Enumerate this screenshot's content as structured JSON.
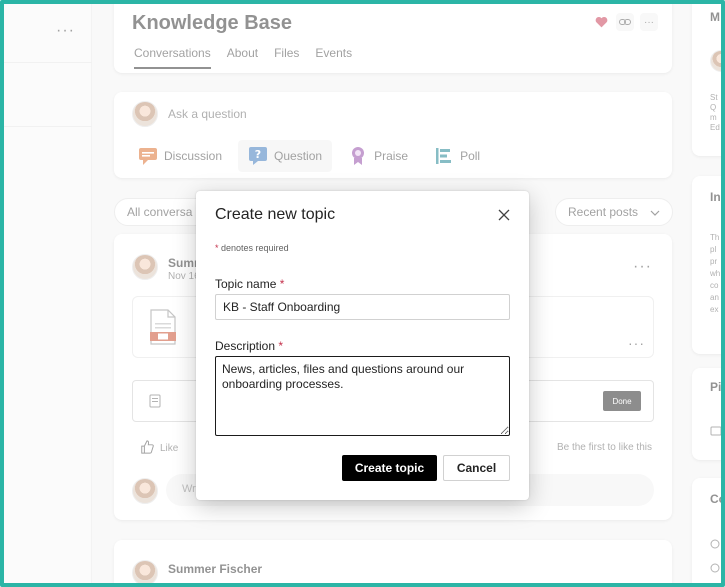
{
  "left_pane": {
    "more_label": "···"
  },
  "header": {
    "title": "Knowledge Base",
    "tabs": [
      {
        "label": "Conversations",
        "active": true
      },
      {
        "label": "About"
      },
      {
        "label": "Files"
      },
      {
        "label": "Events"
      }
    ],
    "icons": [
      "heart-icon",
      "link-icon",
      "more-icon"
    ],
    "more_label": "···"
  },
  "composer": {
    "placeholder": "Ask a question",
    "post_types": [
      {
        "label": "Discussion",
        "icon": "discussion-icon",
        "color": "#d9651e"
      },
      {
        "label": "Question",
        "icon": "question-icon",
        "color": "#2f6fb7",
        "active": true
      },
      {
        "label": "Praise",
        "icon": "praise-icon",
        "color": "#8a3fa0"
      },
      {
        "label": "Poll",
        "icon": "poll-icon",
        "color": "#0f7b8a"
      }
    ]
  },
  "filters": {
    "all_label": "All conversa",
    "sort_label": "Recent posts"
  },
  "post": {
    "author": "Summ",
    "date": "Nov 16",
    "more_label": "···",
    "file_more_label": "···",
    "done_label": "Done",
    "like_label": "Like",
    "first_like": "Be the first to like this",
    "reply_placeholder": "Wr"
  },
  "post2": {
    "author": "Summer Fischer"
  },
  "right_pane": {
    "card1_lines": [
      "M",
      "St",
      "Q",
      "m",
      "Ed"
    ],
    "card2_head": "In",
    "card2_lines": [
      "Th",
      "pl",
      "pr",
      "wh",
      "co",
      "an",
      "ex"
    ],
    "card3_head": "Pi",
    "card4_head": "Co"
  },
  "dialog": {
    "title": "Create new topic",
    "required_star": "*",
    "required_note": "denotes required",
    "topic_label": "Topic name",
    "topic_value": "KB - Staff Onboarding",
    "description_label": "Description",
    "description_value": "News, articles, files and questions around our onboarding processes.",
    "create_label": "Create topic",
    "cancel_label": "Cancel"
  },
  "colors": {
    "frame_border": "#2bb5a6",
    "primary_button": "#000000",
    "required_star": "#c4314b",
    "heart": "#c4314b"
  }
}
